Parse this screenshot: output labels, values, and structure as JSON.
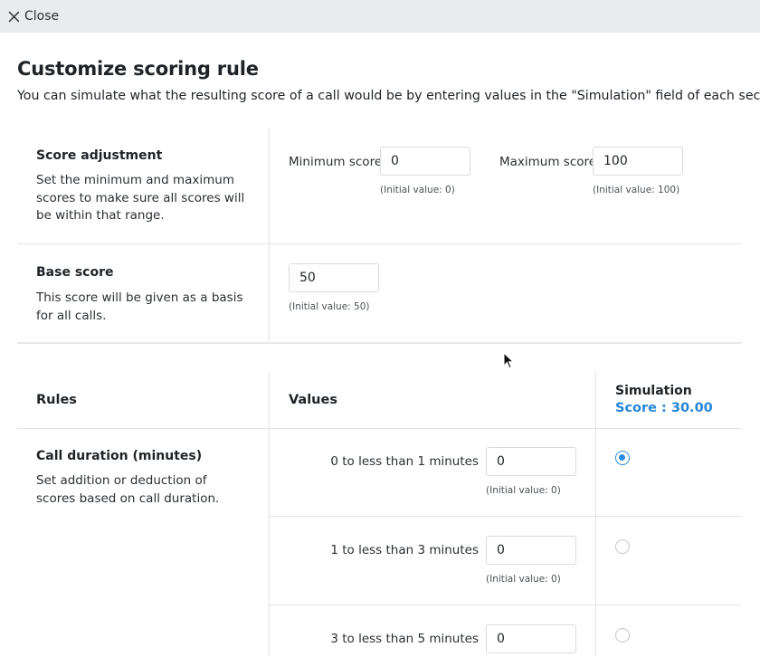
{
  "topbar": {
    "close_label": "Close"
  },
  "page": {
    "title": "Customize scoring rule",
    "subtitle": "You can simulate what the resulting score of a call would be by entering values in the \"Simulation\" field of each section."
  },
  "score_adjustment": {
    "title": "Score adjustment",
    "description": "Set the minimum and maximum scores to make sure all scores will be within that range.",
    "min_label": "Minimum score",
    "min_value": "0",
    "min_hint": "(Initial value: 0)",
    "max_label": "Maximum score",
    "max_value": "100",
    "max_hint": "(Initial value: 100)"
  },
  "base_score": {
    "title": "Base score",
    "description": "This score will be given as a basis for all calls.",
    "value": "50",
    "hint": "(Initial value: 50)"
  },
  "rules_table": {
    "col_rules": "Rules",
    "col_values": "Values",
    "col_simulation": "Simulation",
    "simulation_score": "Score : 30.00",
    "call_duration": {
      "title": "Call duration (minutes)",
      "description": "Set addition or deduction of scores based on call duration.",
      "rows": [
        {
          "label": "0 to less than 1 minutes",
          "value": "0",
          "hint": "(Initial value: 0)",
          "selected": true
        },
        {
          "label": "1 to less than 3 minutes",
          "value": "0",
          "hint": "(Initial value: 0)",
          "selected": false
        },
        {
          "label": "3 to less than 5 minutes",
          "value": "0",
          "hint": "",
          "selected": false
        }
      ]
    }
  },
  "colors": {
    "accent": "#2b8be0",
    "score_text": "#2585d8",
    "topbar_bg": "#e9ebee"
  }
}
